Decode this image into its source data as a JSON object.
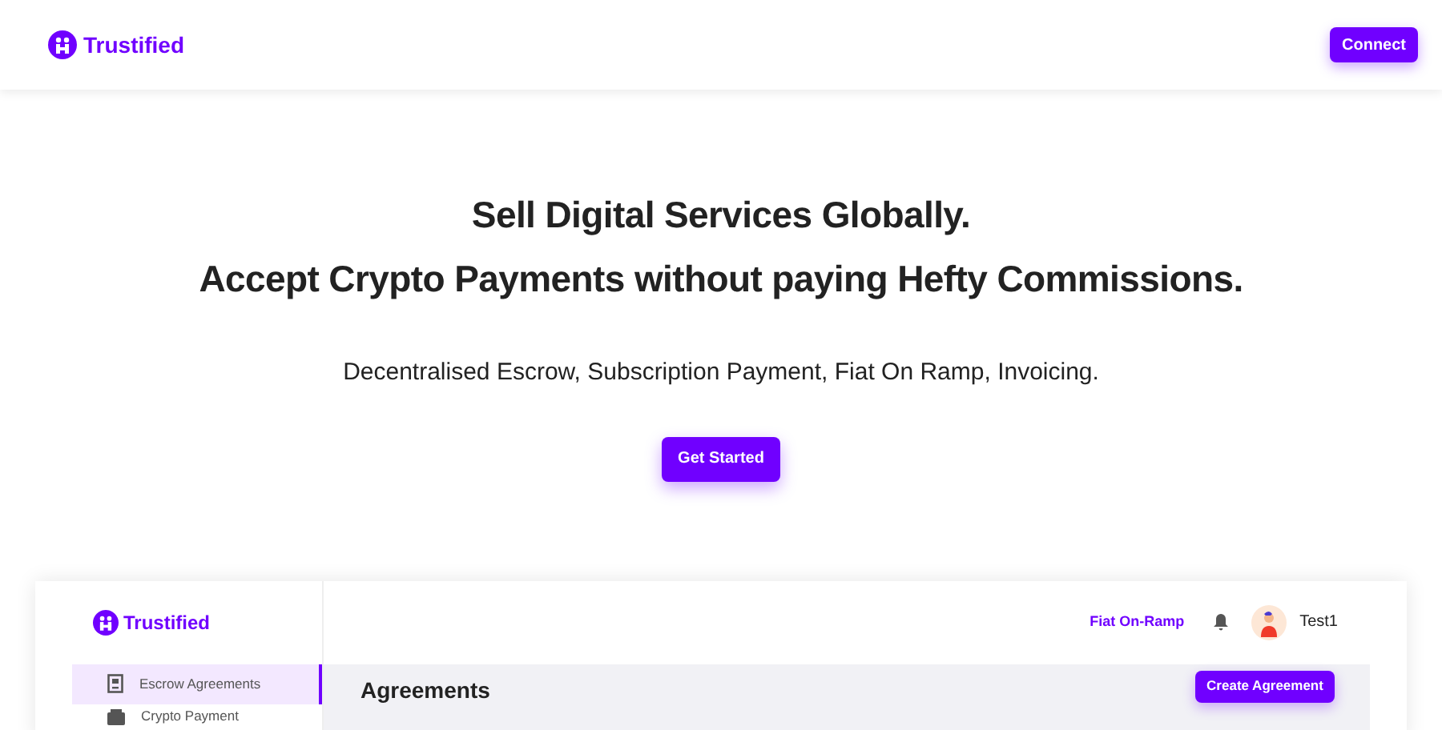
{
  "header": {
    "brand": "Trustified",
    "connect_button": "Connect"
  },
  "hero": {
    "headline": [
      "Sell Digital Services Globally.",
      "Accept Crypto Payments without paying Hefty Commissions."
    ],
    "subtitle": "Decentralised Escrow, Subscription Payment, Fiat On Ramp, Invoicing.",
    "cta": "Get Started"
  },
  "app_preview": {
    "brand": "Trustified",
    "top_link": "Fiat On-Ramp",
    "user": "Test1",
    "sidebar_items": [
      {
        "label": "Escrow Agreements",
        "kind": "document",
        "selected": true
      },
      {
        "label": "Crypto Payment",
        "kind": "wallet",
        "selected": false
      }
    ],
    "page_title": "Agreements",
    "create_button": "Create Agreement"
  }
}
